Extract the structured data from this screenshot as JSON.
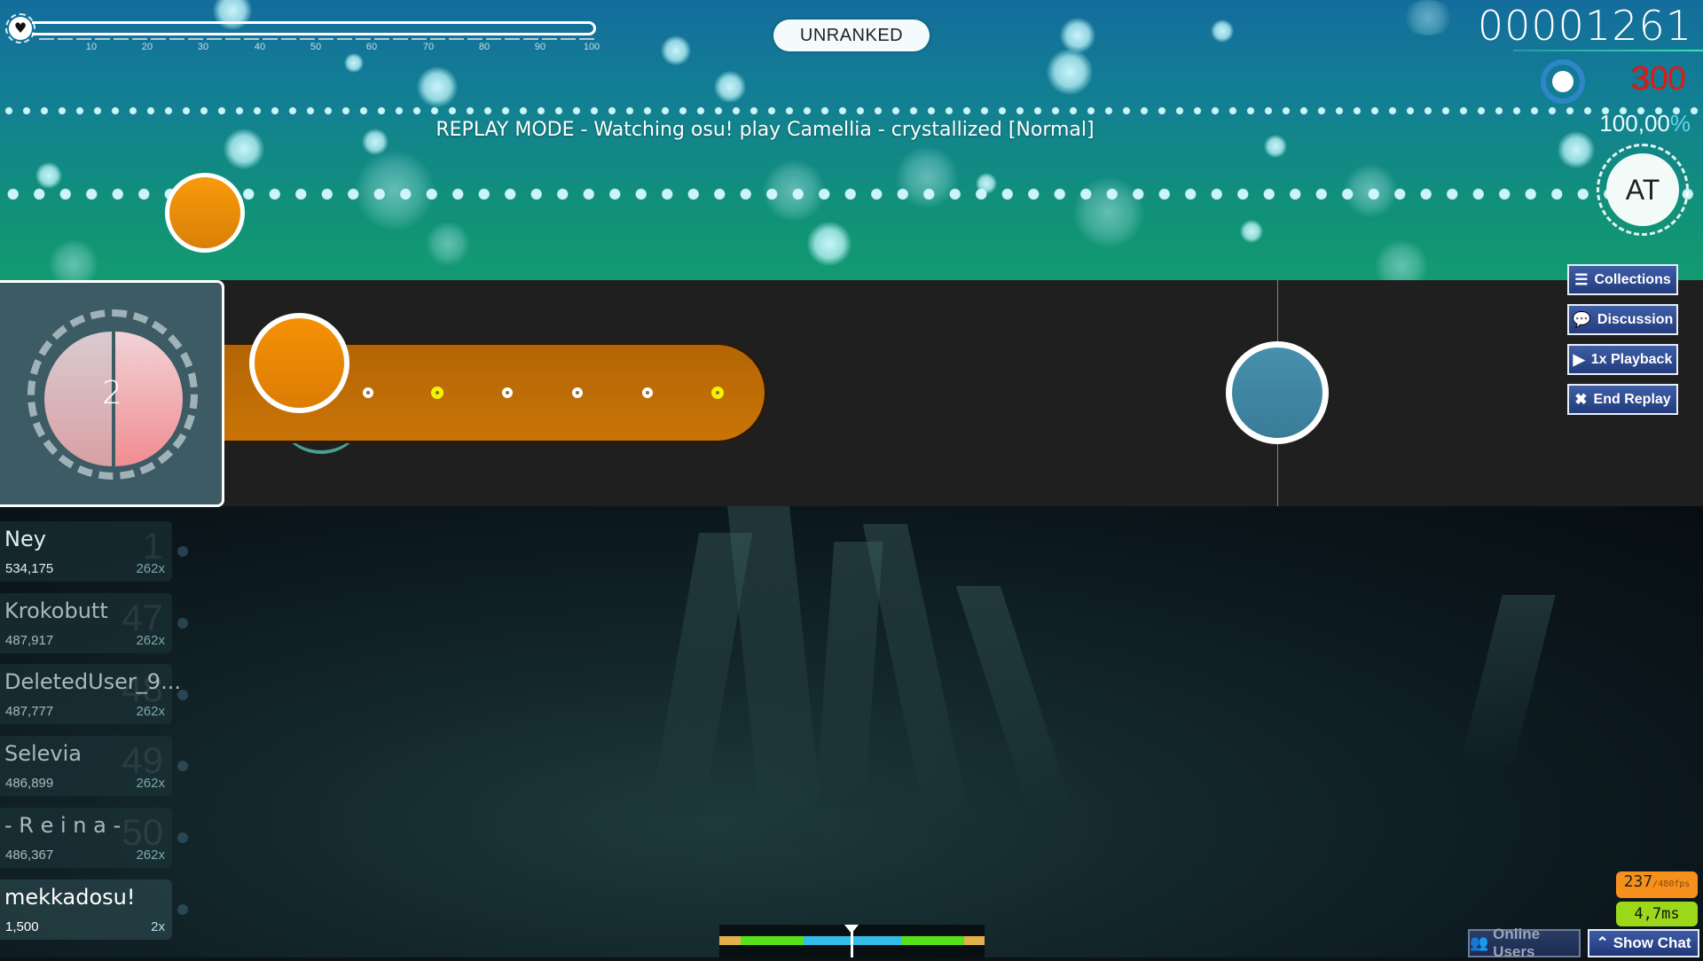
{
  "hud": {
    "health": {
      "value_percent": 100,
      "tick_labels": [
        "10",
        "20",
        "30",
        "40",
        "50",
        "60",
        "70",
        "80",
        "90",
        "100"
      ],
      "icon": "heart-icon"
    },
    "ranking_badge": "UNRANKED",
    "score": "00001261",
    "combo": {
      "ghost_digit": "3",
      "value": "300"
    },
    "accuracy": {
      "value": "100,00",
      "suffix": "%"
    },
    "song_progress_percent": 5,
    "mod_badge": "AT",
    "replay_banner": "REPLAY MODE - Watching osu! play Camellia - crystallized [Normal]"
  },
  "playfield": {
    "spinner_count": "2",
    "slider_ticks": [
      "white",
      "yellow",
      "white",
      "white",
      "white",
      "yellow"
    ],
    "colors": {
      "orange": "#e88a06",
      "blue": "#4187a5",
      "spinner_bg": "#3d5b64",
      "playfield_bg": "#1f1f1f"
    }
  },
  "side_buttons": [
    {
      "label": "Collections",
      "icon": "list-icon"
    },
    {
      "label": "Discussion",
      "icon": "chat-bubbles-icon"
    },
    {
      "label": "1x Playback",
      "icon": "play-icon"
    },
    {
      "label": "End Replay",
      "icon": "close-icon"
    }
  ],
  "leaderboard": [
    {
      "name": "Ney",
      "score": "534,175",
      "combo": "262x",
      "rank": "1"
    },
    {
      "name": "Krokobutt",
      "score": "487,917",
      "combo": "262x",
      "rank": "47"
    },
    {
      "name": "DeletedUser_9...",
      "score": "487,777",
      "combo": "262x",
      "rank": "48"
    },
    {
      "name": "Selevia",
      "score": "486,899",
      "combo": "262x",
      "rank": "49"
    },
    {
      "name": "- R e i n a -",
      "score": "486,367",
      "combo": "262x",
      "rank": "50"
    },
    {
      "name": "mekkadosu!",
      "score": "1,500",
      "combo": "2x",
      "rank": ""
    }
  ],
  "performance": {
    "fps": "237",
    "fps_max": "/480fps",
    "latency": "4,7ms"
  },
  "bottom_bar": {
    "online_users_label": "Online Users",
    "show_chat_label": "Show Chat"
  },
  "hit_error_bar": {
    "colors": {
      "meh": "#e3b04b",
      "good": "#57e11a",
      "great": "#32bce7"
    }
  }
}
